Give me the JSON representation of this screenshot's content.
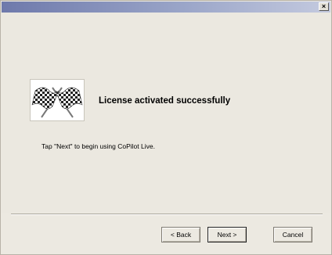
{
  "window": {
    "close_glyph": "×"
  },
  "main": {
    "heading": "License activated successfully",
    "message": "Tap \"Next\" to begin using CoPilot Live.",
    "logo_icon": "checkered-flags-icon"
  },
  "buttons": {
    "back": "< Back",
    "next": "Next >",
    "cancel": "Cancel"
  }
}
